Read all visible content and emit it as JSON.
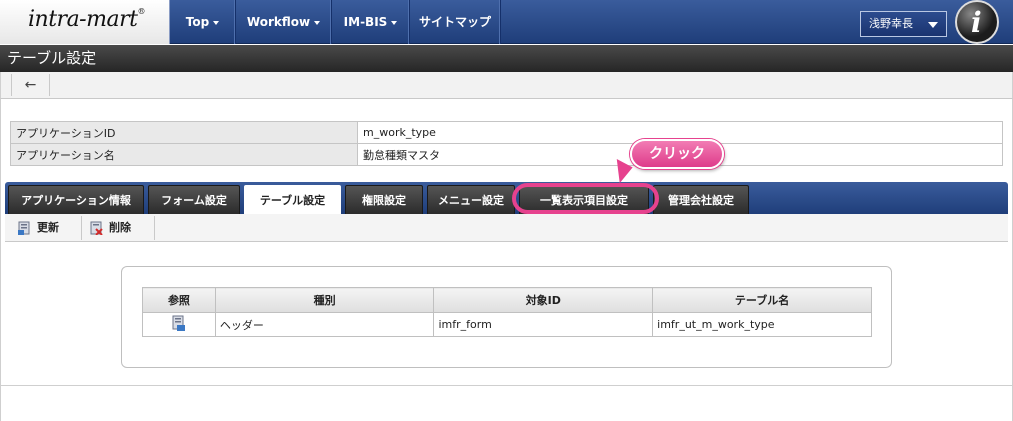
{
  "header": {
    "logo_text": "intra-mart",
    "logo_mark": "®",
    "nav": [
      {
        "label": "Top",
        "dropdown": true
      },
      {
        "label": "Workflow",
        "dropdown": true
      },
      {
        "label": "IM-BIS",
        "dropdown": true
      },
      {
        "label": "サイトマップ",
        "dropdown": false
      }
    ],
    "user_name": "浅野幸長",
    "avatar_glyph": "i"
  },
  "page": {
    "title": "テーブル設定",
    "back_icon": "←"
  },
  "info": {
    "rows": [
      {
        "label": "アプリケーションID",
        "value": "m_work_type"
      },
      {
        "label": "アプリケーション名",
        "value": "勤怠種類マスタ"
      }
    ]
  },
  "tabs": [
    {
      "label": "アプリケーション情報",
      "active": false
    },
    {
      "label": "フォーム設定",
      "active": false
    },
    {
      "label": "テーブル設定",
      "active": true
    },
    {
      "label": "権限設定",
      "active": false
    },
    {
      "label": "メニュー設定",
      "active": false
    },
    {
      "label": "一覧表示項目設定",
      "active": false
    },
    {
      "label": "管理会社設定",
      "active": false
    }
  ],
  "callout": {
    "label": "クリック",
    "color": "#e6428e"
  },
  "actions": [
    {
      "label": "更新",
      "icon": "update-icon"
    },
    {
      "label": "削除",
      "icon": "delete-icon"
    }
  ],
  "table": {
    "headers": [
      "参照",
      "種別",
      "対象ID",
      "テーブル名"
    ],
    "rows": [
      {
        "ref_icon": "reference-icon",
        "type": "ヘッダー",
        "target_id": "imfr_form",
        "table_name": "imfr_ut_m_work_type"
      }
    ]
  },
  "colors": {
    "accent": "#2a4c8c",
    "title_bar": "#333333",
    "highlight": "#e6428e"
  }
}
